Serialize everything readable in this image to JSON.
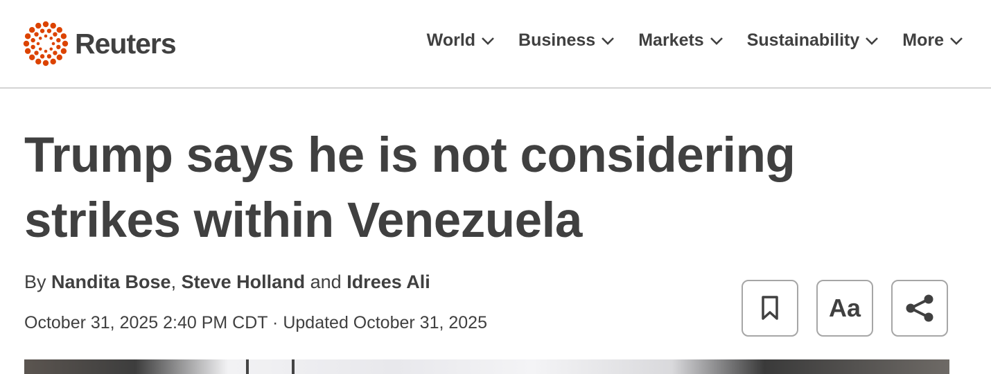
{
  "brand": {
    "name": "Reuters",
    "logo_icon": "reuters-dot-ring-icon",
    "accent_color": "#dc4300"
  },
  "nav": {
    "items": [
      {
        "label": "World",
        "icon": "chevron-down-icon"
      },
      {
        "label": "Business",
        "icon": "chevron-down-icon"
      },
      {
        "label": "Markets",
        "icon": "chevron-down-icon"
      },
      {
        "label": "Sustainability",
        "icon": "chevron-down-icon"
      },
      {
        "label": "More",
        "icon": "chevron-down-icon"
      }
    ]
  },
  "article": {
    "headline_line1": "Trump says he is not considering",
    "headline_line2": "strikes within Venezuela",
    "byline": {
      "prefix": "By ",
      "author1": "Nandita Bose",
      "sep1": ", ",
      "author2": "Steve Holland",
      "sep2": " and ",
      "author3": "Idrees Ali"
    },
    "dateline": "October 31, 2025 2:40 PM CDT · Updated October 31, 2025"
  },
  "tools": {
    "bookmark_icon": "bookmark-icon",
    "font_size_label": "Aa",
    "share_icon": "share-icon"
  }
}
